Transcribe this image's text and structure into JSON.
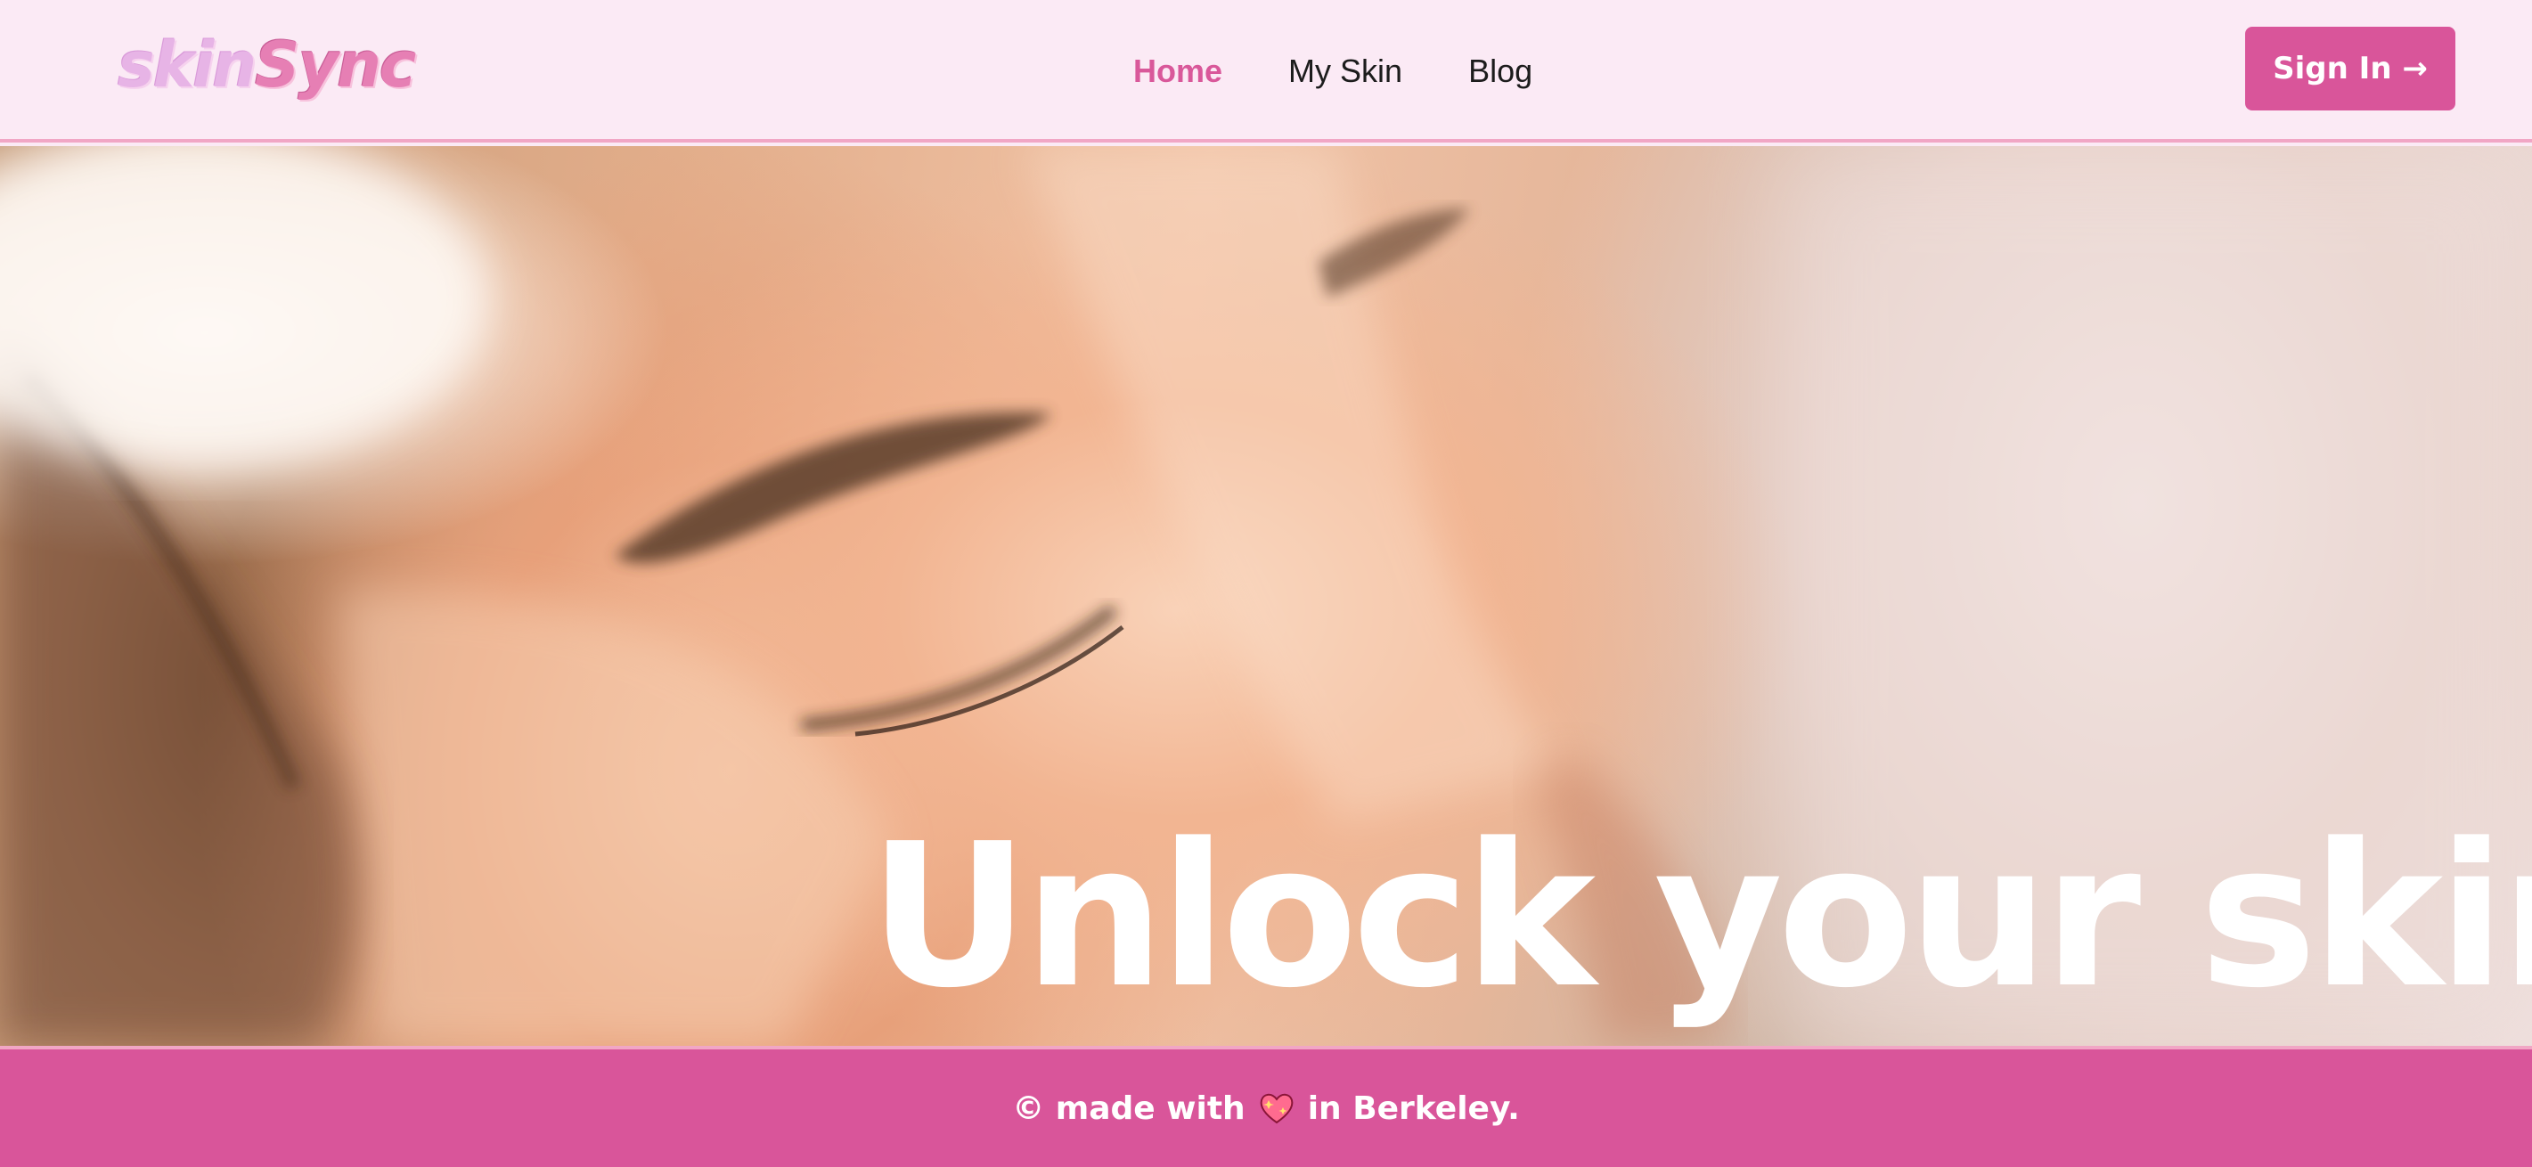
{
  "header": {
    "logo_part_a": "skin",
    "logo_part_b": "Sync",
    "nav": [
      {
        "label": "Home",
        "active": true
      },
      {
        "label": "My Skin",
        "active": false
      },
      {
        "label": "Blog",
        "active": false
      }
    ],
    "signin_label": "Sign In →"
  },
  "hero": {
    "headline": "Unlock your skin",
    "image_icon": "portrait-photo"
  },
  "footer": {
    "prefix": "© made with",
    "icon": "sparkling-heart-icon",
    "suffix": "in Berkeley."
  },
  "colors": {
    "accent": "#d9559a",
    "header_bg": "#fbeaf5",
    "border": "#f1a6c5",
    "text": "#1c1c1c",
    "white": "#ffffff"
  }
}
